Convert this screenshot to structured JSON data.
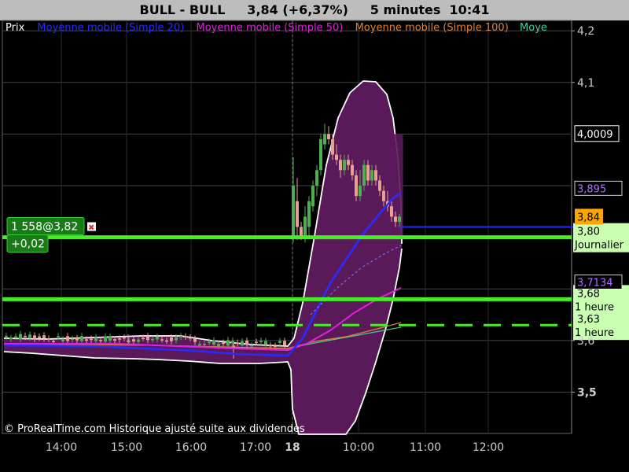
{
  "header": {
    "symbol": "BULL - BULL",
    "price_change": "3,84 (+6,37%)",
    "timeframe": "5 minutes",
    "time": "10:41"
  },
  "legend": [
    {
      "label": "Prix",
      "color": "#ffffff"
    },
    {
      "label": "Moyenne mobile (Simple 20)",
      "color": "#2a2aff"
    },
    {
      "label": "Moyenne mobile (Simple 50)",
      "color": "#e020e0"
    },
    {
      "label": "Moyenne mobile (Simple 100)",
      "color": "#e08030"
    },
    {
      "label": "Moye",
      "color": "#40d0a0"
    }
  ],
  "colors": {
    "background": "#000000",
    "grid": "#444444",
    "bollinger_fill": "#5a1a5a",
    "bollinger_edge": "#ffffff",
    "candle_up": "#4caf50",
    "candle_down": "#e8a090",
    "support_line": "#44ee22",
    "ma20": "#2a2aff",
    "ma50": "#e020e0",
    "ma100": "#e08030",
    "ma200": "#40d0a0",
    "order_green": "#1a7a1a",
    "last_price_bg": "#ffa500"
  },
  "chart_data": {
    "type": "candlestick",
    "ylim": [
      3.42,
      4.22
    ],
    "x_tick_labels": [
      "14:00",
      "15:00",
      "16:00",
      "17:00",
      "18",
      "10:00",
      "11:00",
      "12:00"
    ],
    "y_tick_labels": [
      {
        "value": 4.2,
        "label": "4,2"
      },
      {
        "value": 4.1,
        "label": "4,1"
      },
      {
        "value": 3.6,
        "label": "3,6"
      },
      {
        "value": 3.5,
        "label": "3,5"
      }
    ],
    "horizontal_levels": [
      {
        "value": 3.8,
        "label": "3,80",
        "sublabel": "Journalier",
        "style": "solid"
      },
      {
        "value": 3.68,
        "label": "3,68",
        "sublabel": "1 heure",
        "style": "solid"
      },
      {
        "value": 3.63,
        "label": "3,63",
        "sublabel": "1 heure",
        "style": "dashed"
      }
    ],
    "price_markers": [
      {
        "value": 4.0009,
        "label": "4,0009",
        "type": "box-white"
      },
      {
        "value": 3.895,
        "label": "3,895",
        "type": "text-violet"
      },
      {
        "value": 3.84,
        "label": "3,84",
        "type": "last-price"
      },
      {
        "value": 3.7134,
        "label": "3,7134",
        "type": "text-violet"
      }
    ],
    "position": {
      "label": "1 558@3,82",
      "value": 3.82,
      "pnl": "+0,02"
    },
    "ma20_last": 3.82,
    "footer": "© ProRealTime.com Historique ajusté suite aux dividendes"
  }
}
